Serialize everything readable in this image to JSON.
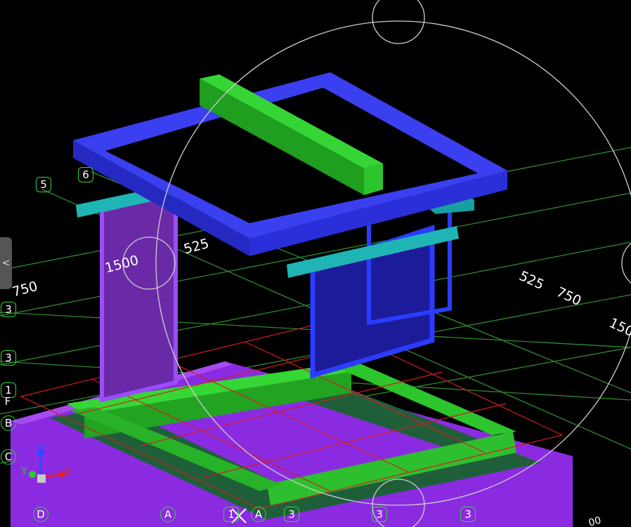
{
  "viewport": {
    "side_tab_glyph": "<",
    "dimensions": [
      "525",
      "1500",
      "750",
      "525",
      "750",
      "150",
      "00"
    ],
    "grid_bubbles": [
      "5",
      "6",
      "3",
      "3",
      "1",
      "F",
      "B",
      "C",
      "D",
      "A",
      "1",
      "A",
      "3",
      "3",
      "3"
    ],
    "axes": {
      "x": "X",
      "y": "Y",
      "z": "Z"
    }
  },
  "colors": {
    "background": "#000000",
    "grid": "#2f8a2f",
    "red_grid": "#d41c1c",
    "purple": "#8e2ee6",
    "green": "#2cc52c",
    "blue": "#2a2fd9",
    "cyan": "#1fb5b5",
    "orbit": "#cfcfcf"
  }
}
